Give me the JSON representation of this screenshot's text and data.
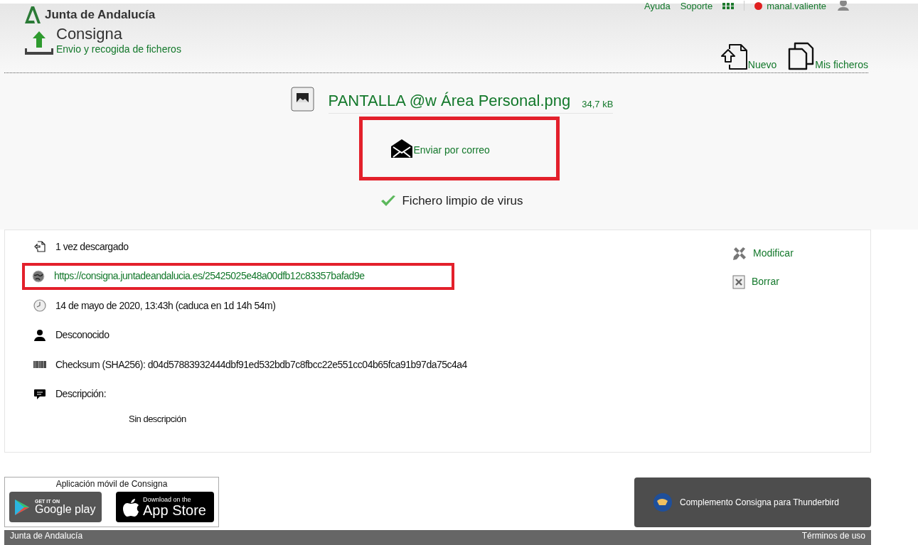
{
  "header": {
    "brand": "Junta de Andalucía",
    "app_title": "Consigna",
    "app_subtitle": "Envio y recogida de ficheros",
    "top_links": [
      "Ayuda",
      "Soporte"
    ],
    "user": "manal.valiente",
    "actions": [
      {
        "kind": "new",
        "label": "Nuevo"
      },
      {
        "kind": "files",
        "label": "Mis ficheros"
      }
    ]
  },
  "file": {
    "name": "PANTALLA @w Área Personal.png",
    "size": "34,7 kB",
    "email_action": "Enviar por correo",
    "virus_status": "Fichero limpio de virus"
  },
  "details": [
    {
      "kind": "downloads",
      "text": "1 vez descargado",
      "highlighted": false
    },
    {
      "kind": "link",
      "text": "https://consigna.juntadeandalucia.es/25425025e48a00dfb12c83357bafad9e",
      "highlighted": true
    },
    {
      "kind": "date",
      "text": "14 de mayo de 2020, 13:43h (caduca en 1d 14h 54m)",
      "highlighted": false
    },
    {
      "kind": "owner",
      "text": "Desconocido",
      "highlighted": false
    },
    {
      "kind": "checksum",
      "text": "Checksum (SHA256): d04d57883932444dbf91ed532bdb7c8fbcc22e551cc04b65fca91b97da75c4a4",
      "highlighted": false
    },
    {
      "kind": "description",
      "text": "Descripción:",
      "highlighted": false
    }
  ],
  "description_value": "Sin descripción",
  "side_actions": [
    {
      "kind": "edit",
      "label": "Modificar"
    },
    {
      "kind": "delete",
      "label": "Borrar"
    }
  ],
  "footer": {
    "mobile_title": "Aplicación móvil de Consigna",
    "google_small": "GET IT ON",
    "google_big": "Google play",
    "apple_small": "Download on the",
    "apple_big": "App Store",
    "thunderbird": "Complemento Consigna para Thunderbird",
    "bottom_left": "Junta de Andalucía",
    "bottom_right": "Términos de uso"
  }
}
